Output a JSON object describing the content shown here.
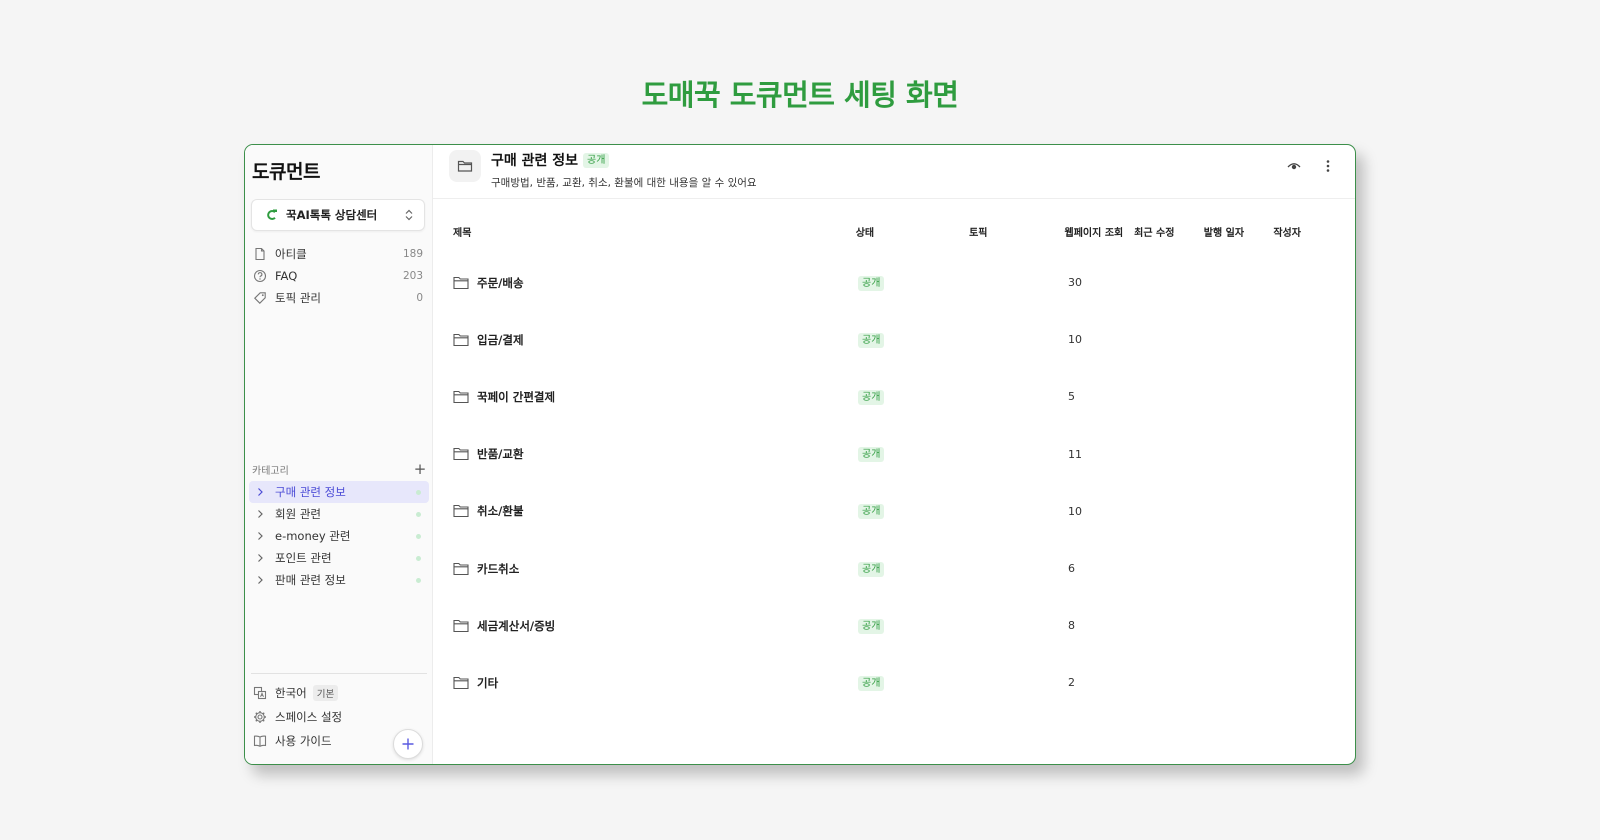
{
  "page_heading": "도매꾹 도큐먼트 세팅 화면",
  "colors": {
    "accent_green": "#2f9c3f",
    "active_purple": "#4b4bd6",
    "frame_border": "#3c8f4a"
  },
  "sidebar": {
    "title": "도큐먼트",
    "space": {
      "name": "꾹AI톡톡 상담센터",
      "icon": "space-logo-icon"
    },
    "nav": [
      {
        "label": "아티클",
        "count": "189",
        "icon": "document-icon"
      },
      {
        "label": "FAQ",
        "count": "203",
        "icon": "question-circle-icon"
      },
      {
        "label": "토픽 관리",
        "count": "0",
        "icon": "tag-icon"
      }
    ],
    "category_header": "카테고리",
    "categories": [
      {
        "label": "구매 관련 정보",
        "active": true
      },
      {
        "label": "회원 관련",
        "active": false
      },
      {
        "label": "e-money 관련",
        "active": false
      },
      {
        "label": "포인트 관련",
        "active": false
      },
      {
        "label": "판매 관련 정보",
        "active": false
      }
    ],
    "bottom": {
      "language": "한국어",
      "language_badge": "기본",
      "settings": "스페이스 설정",
      "guide": "사용 가이드"
    }
  },
  "main": {
    "title": "구매 관련 정보",
    "title_badge": "공개",
    "description": "구매방법, 반품, 교환, 취소, 환불에 대한 내용을 알 수 있어요",
    "columns": {
      "title": "제목",
      "status": "상태",
      "topic": "토픽",
      "views": "웹페이지 조회",
      "modified": "최근 수정",
      "published": "발행 일자",
      "author": "작성자"
    },
    "rows": [
      {
        "title": "주문/배송",
        "status": "공개",
        "views": "30"
      },
      {
        "title": "입금/결제",
        "status": "공개",
        "views": "10"
      },
      {
        "title": "꾹페이 간편결제",
        "status": "공개",
        "views": "5"
      },
      {
        "title": "반품/교환",
        "status": "공개",
        "views": "11"
      },
      {
        "title": "취소/환불",
        "status": "공개",
        "views": "10"
      },
      {
        "title": "카드취소",
        "status": "공개",
        "views": "6"
      },
      {
        "title": "세금계산서/증빙",
        "status": "공개",
        "views": "8"
      },
      {
        "title": "기타",
        "status": "공개",
        "views": "2"
      }
    ]
  }
}
